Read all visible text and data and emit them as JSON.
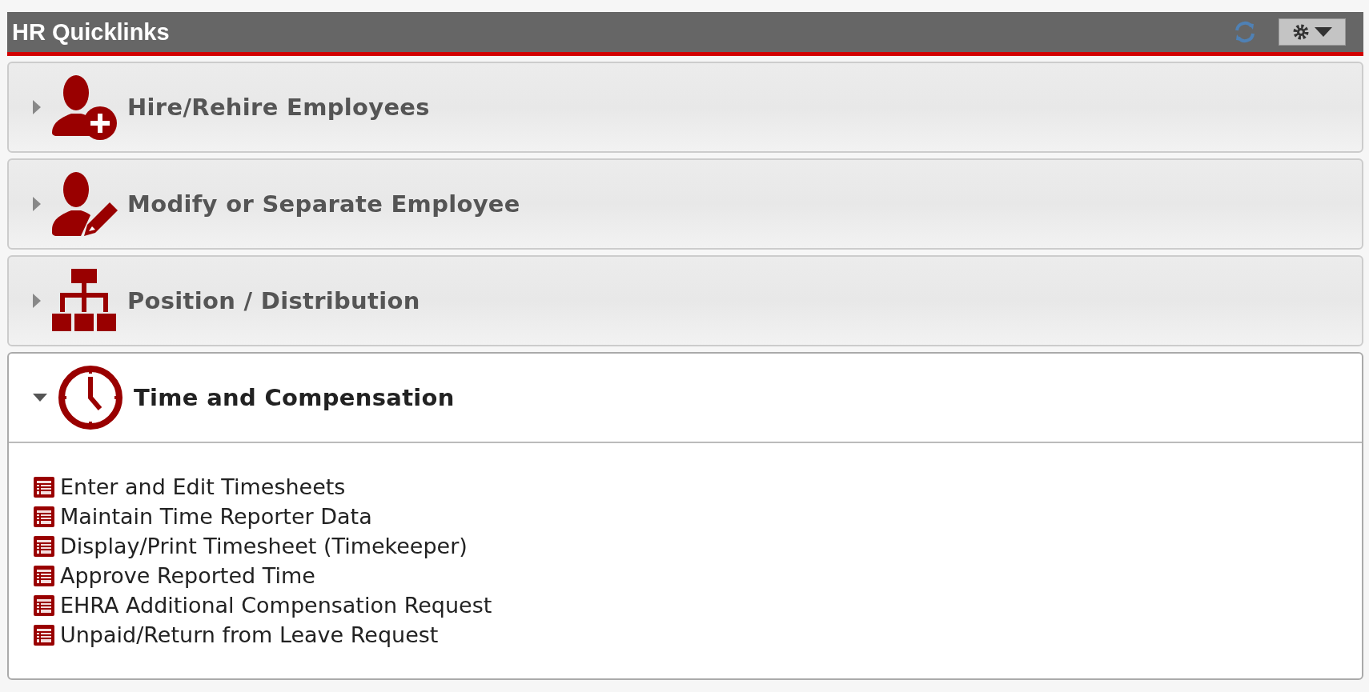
{
  "panel": {
    "title": "HR Quicklinks"
  },
  "sections": [
    {
      "title": "Hire/Rehire Employees",
      "kind": "person-add",
      "expanded": false
    },
    {
      "title": "Modify or Separate Employee",
      "kind": "person-edit",
      "expanded": false
    },
    {
      "title": "Position / Distribution",
      "kind": "org-chart",
      "expanded": false
    },
    {
      "title": "Time and Compensation",
      "kind": "clock",
      "expanded": true,
      "links": [
        "Enter and Edit Timesheets",
        "Maintain Time Reporter Data",
        "Display/Print Timesheet (Timekeeper)",
        "Approve Reported Time",
        "EHRA Additional Compensation Request",
        "Unpaid/Return from Leave Request"
      ]
    }
  ]
}
